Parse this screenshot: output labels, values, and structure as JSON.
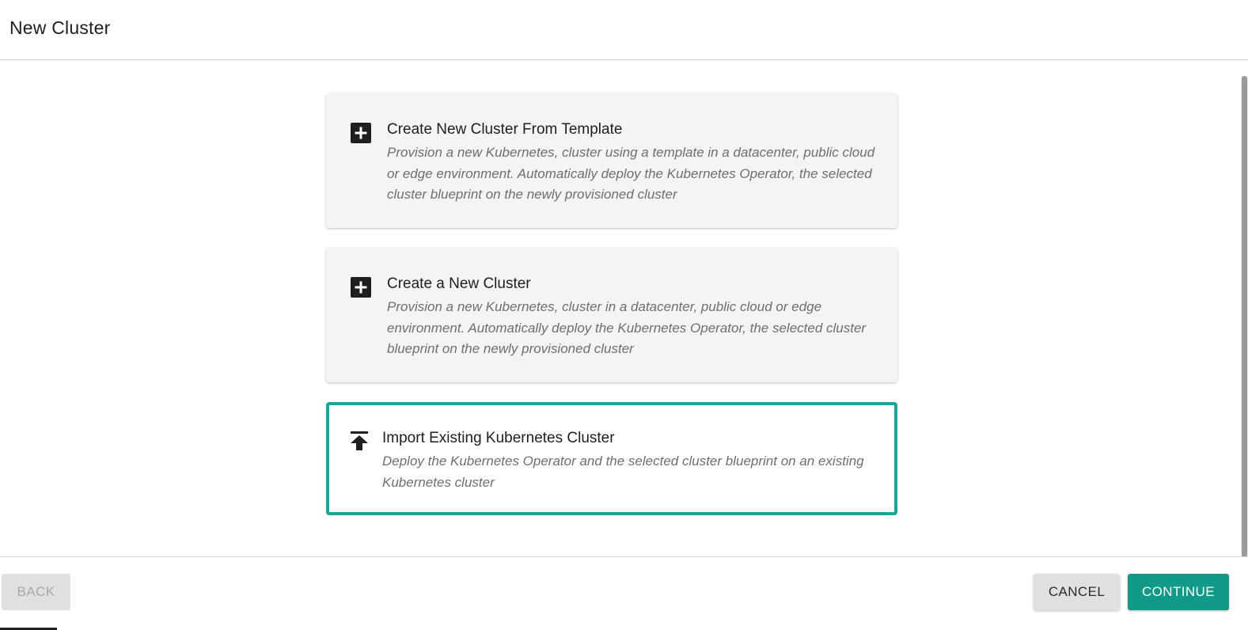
{
  "dialog": {
    "title": "New Cluster"
  },
  "options": [
    {
      "title": "Create New Cluster From Template",
      "description": "Provision a new Kubernetes, cluster using a template in a datacenter, public cloud or edge environment. Automatically deploy the Kubernetes Operator, the selected cluster blueprint on the newly provisioned cluster",
      "icon": "plus-box-icon",
      "selected": false
    },
    {
      "title": "Create a New Cluster",
      "description": "Provision a new Kubernetes, cluster in a datacenter, public cloud or edge environment. Automatically deploy the Kubernetes Operator, the selected cluster blueprint on the newly provisioned cluster",
      "icon": "plus-box-icon",
      "selected": false
    },
    {
      "title": "Import Existing Kubernetes Cluster",
      "description": "Deploy the Kubernetes Operator and the selected cluster blueprint on an existing Kubernetes cluster",
      "icon": "upload-icon",
      "selected": true
    }
  ],
  "footer": {
    "back_label": "BACK",
    "cancel_label": "CANCEL",
    "continue_label": "CONTINUE"
  },
  "colors": {
    "accent": "#16a896",
    "primary_button": "#0f9a87",
    "card_background": "#f4f4f4",
    "disabled_text": "#a8a8a8"
  }
}
